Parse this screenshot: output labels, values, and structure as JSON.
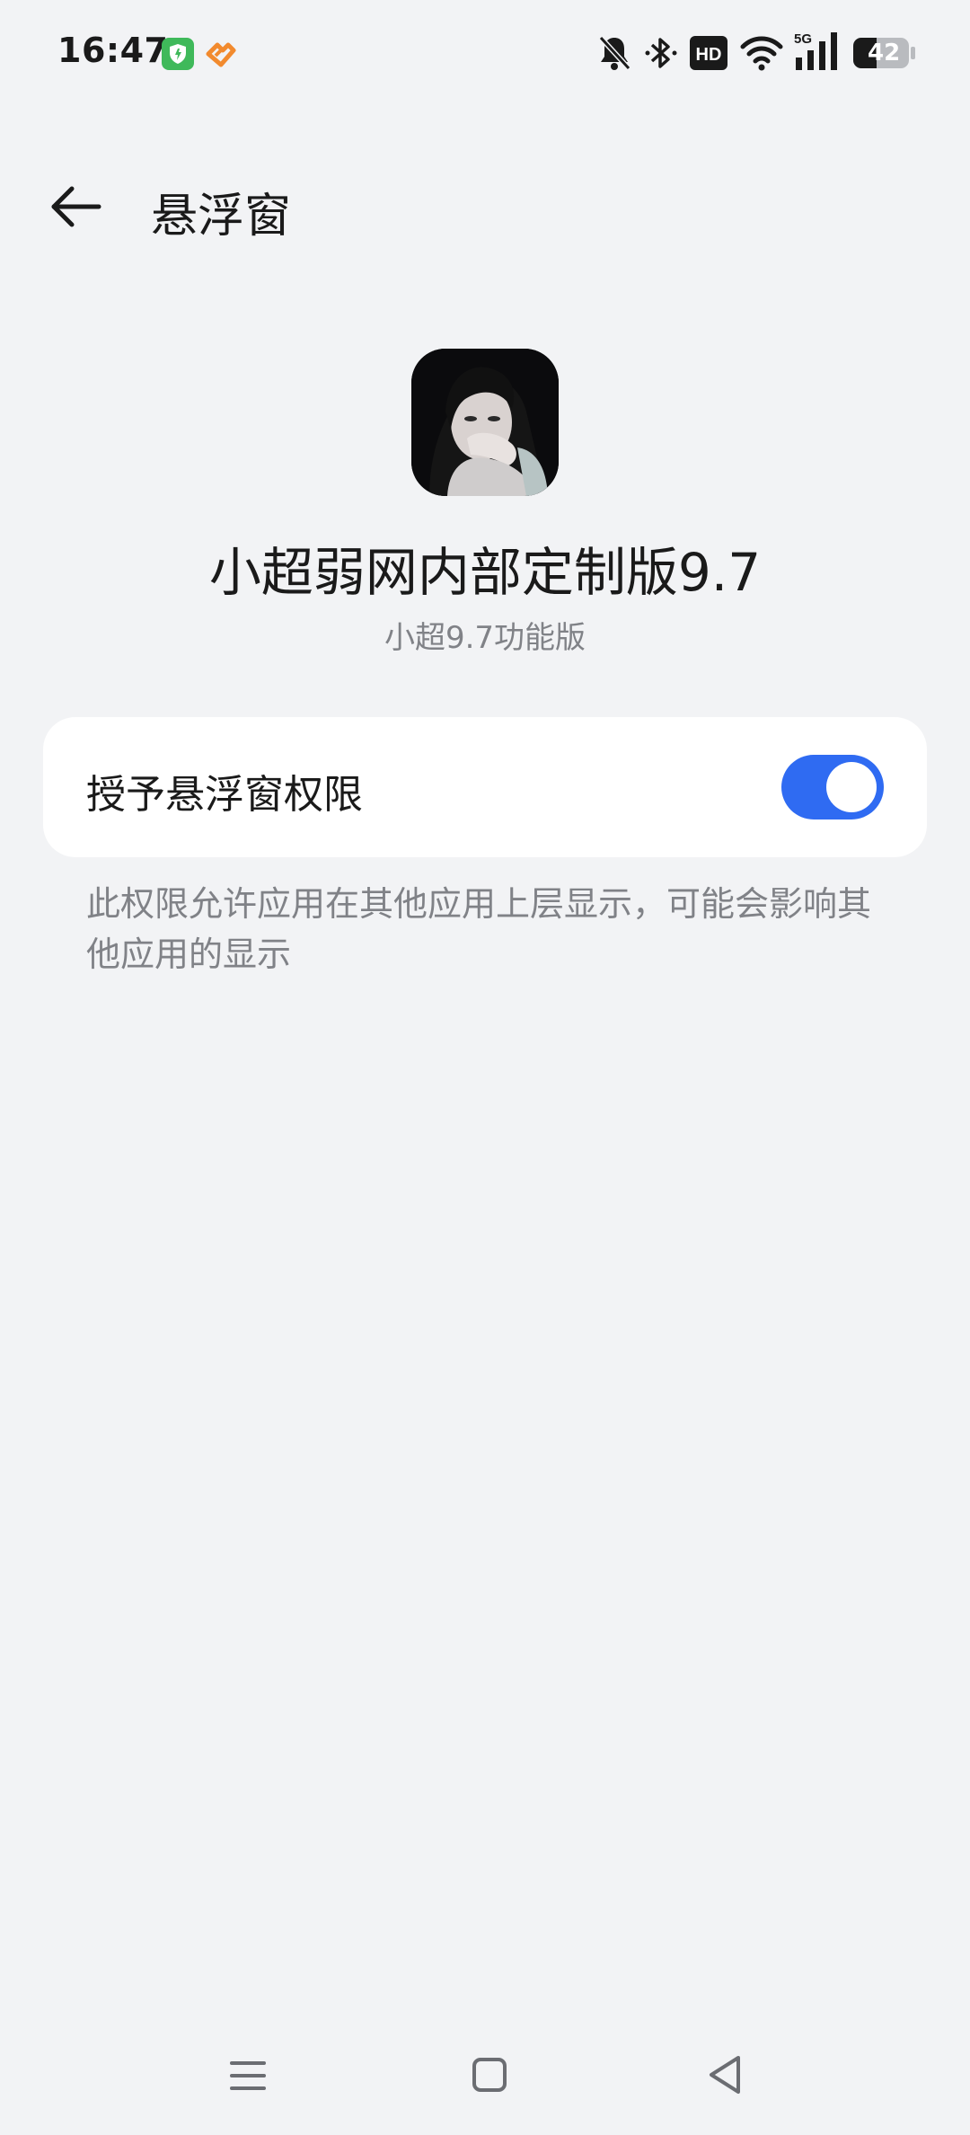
{
  "status_bar": {
    "time": "16:47",
    "battery_level": "42",
    "icons": [
      "shield-app-icon",
      "orange-app-icon",
      "mute-bell-icon",
      "bluetooth-icon",
      "hd-icon",
      "wifi-icon",
      "5g-signal-icon",
      "battery-icon"
    ],
    "network_label": "5G",
    "hd_label": "HD"
  },
  "toolbar": {
    "title": "悬浮窗"
  },
  "app": {
    "name": "小超弱网内部定制版9.7",
    "subtitle": "小超9.7功能版"
  },
  "permission": {
    "label": "授予悬浮窗权限",
    "enabled": true
  },
  "description": "此权限允许应用在其他应用上层显示，可能会影响其他应用的显示",
  "nav_bar": {
    "buttons": [
      "menu-icon",
      "home-icon",
      "back-triangle-icon"
    ]
  },
  "colors": {
    "background": "#f2f3f5",
    "accent": "#2f6bf2",
    "card": "#ffffff",
    "secondary_text": "#808287"
  }
}
